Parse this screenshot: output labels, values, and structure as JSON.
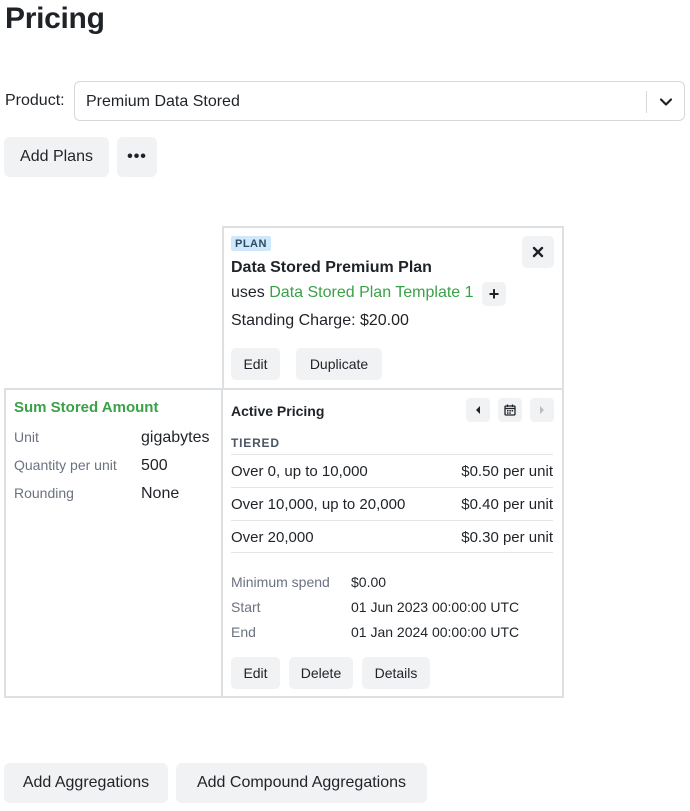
{
  "page": {
    "title": "Pricing"
  },
  "product": {
    "label": "Product:",
    "selected": "Premium Data Stored"
  },
  "toolbar": {
    "add_plans_label": "Add Plans",
    "more_label": "•••"
  },
  "plan": {
    "badge": "PLAN",
    "name": "Data Stored Premium Plan",
    "uses_prefix": "uses ",
    "template_link": "Data Stored Plan Template 1",
    "add_label": "+",
    "standing_charge": "Standing Charge: $20.00",
    "edit_label": "Edit",
    "duplicate_label": "Duplicate"
  },
  "aggregation": {
    "name": "Sum Stored Amount",
    "fields": [
      {
        "key": "Unit",
        "value": "gigabytes"
      },
      {
        "key": "Quantity per unit",
        "value": "500"
      },
      {
        "key": "Rounding",
        "value": "None"
      }
    ]
  },
  "pricing": {
    "title": "Active Pricing",
    "model": "TIERED",
    "tiers": [
      {
        "range": "Over 0, up to 10,000",
        "price": "$0.50 per unit"
      },
      {
        "range": "Over 10,000, up to 20,000",
        "price": "$0.40 per unit"
      },
      {
        "range": "Over 20,000",
        "price": "$0.30 per unit"
      }
    ],
    "meta": [
      {
        "key": "Minimum spend",
        "value": "$0.00"
      },
      {
        "key": "Start",
        "value": "01 Jun 2023 00:00:00 UTC"
      },
      {
        "key": "End",
        "value": "01 Jan 2024 00:00:00 UTC"
      }
    ],
    "edit_label": "Edit",
    "delete_label": "Delete",
    "details_label": "Details"
  },
  "footer": {
    "add_aggregations_label": "Add Aggregations",
    "add_compound_label": "Add Compound Aggregations"
  },
  "colors": {
    "accent_green": "#3aa148",
    "badge_bg": "#cfe8fb",
    "button_bg": "#f1f2f4",
    "border": "#dde0e3"
  },
  "icons": [
    "chevron-down-icon",
    "more-icon",
    "close-icon",
    "plus-icon",
    "chevron-left-icon",
    "calendar-icon",
    "chevron-right-icon"
  ]
}
